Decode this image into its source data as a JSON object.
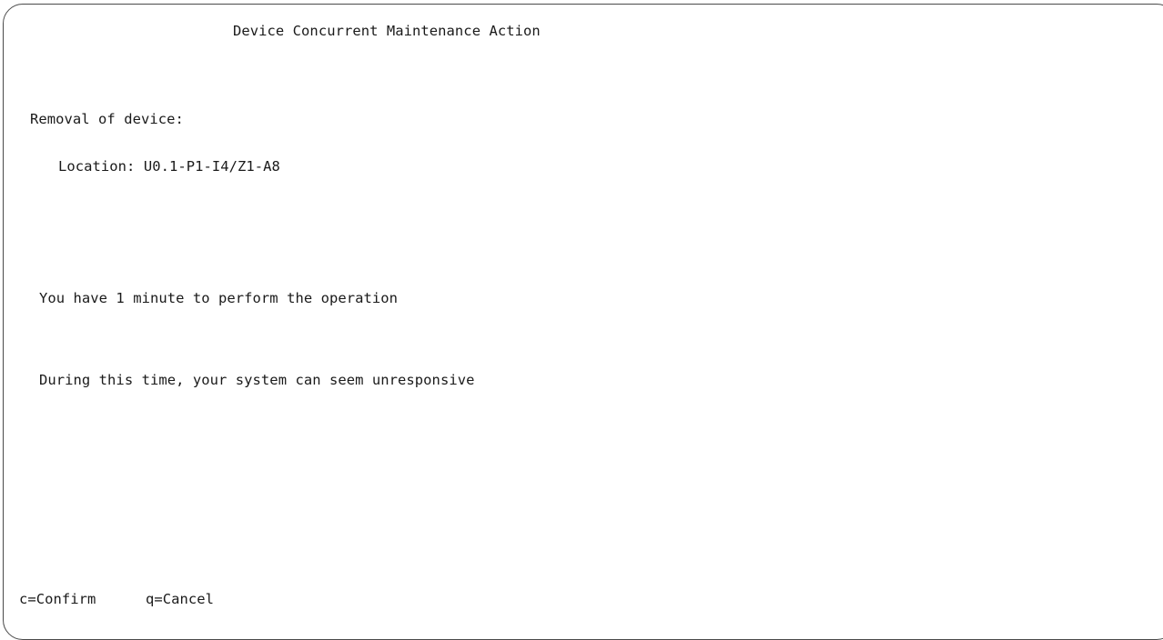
{
  "screen": {
    "title": "Device Concurrent Maintenance Action",
    "removal_label": "Removal of device:",
    "location_label": "Location:",
    "location_value": "U0.1-P1-I4/Z1-A8",
    "operation_message": "You have 1 minute to perform the operation",
    "unresponsive_message": "During this time, your system can seem unresponsive"
  },
  "function_keys": {
    "confirm": "c=Confirm",
    "cancel": "q=Cancel"
  }
}
